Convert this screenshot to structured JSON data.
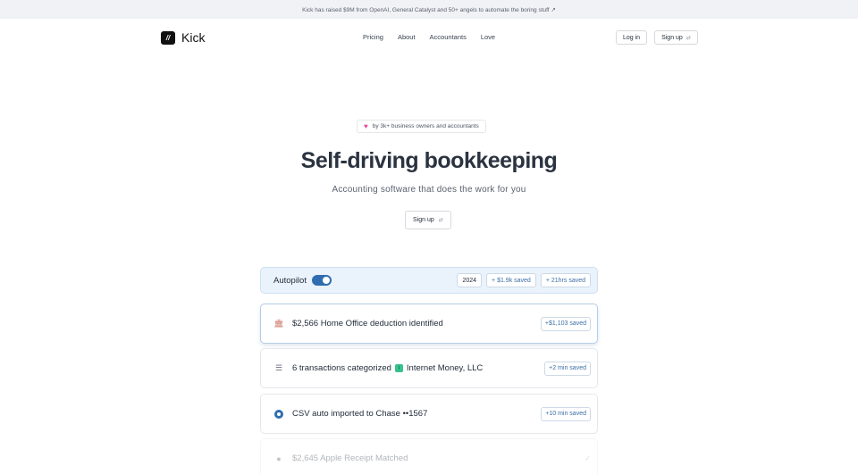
{
  "announcement": "Kick has raised $9M from OpenAI, General Catalyst and 50+ angels to automate the boring stuff ↗",
  "brand": {
    "mark": "//",
    "name": "Kick"
  },
  "nav": [
    "Pricing",
    "About",
    "Accountants",
    "Love"
  ],
  "auth": {
    "login": "Log in",
    "signup": "Sign up",
    "signup_arrow": "⇄"
  },
  "hero": {
    "badge": "by 3k+ business owners and accountants",
    "title": "Self-driving bookkeeping",
    "subtitle": "Accounting software that does the work for you",
    "cta": "Sign up"
  },
  "autopilot": {
    "label": "Autopilot",
    "enabled": true,
    "year": "2024",
    "saved_money": "+ $1.9k saved",
    "saved_time": "+ 21hrs saved"
  },
  "feed": [
    {
      "icon": "bank-icon",
      "text": "$2,566 Home Office deduction identified",
      "pill": "+$1,103 saved"
    },
    {
      "icon": "list-icon",
      "text": "6 transactions categorized",
      "merchant": "Internet Money, LLC",
      "pill": "+2 min saved"
    },
    {
      "icon": "chase-icon",
      "text": "CSV auto imported to Chase ••1567",
      "pill": "+10 min saved"
    },
    {
      "icon": "apple-icon",
      "text": "$2,645 Apple Receipt Matched",
      "status": "✓"
    }
  ],
  "colors": {
    "accent": "#2f6db0",
    "autopilot_bg": "#eaf2fb",
    "heart": "#ec4899"
  }
}
